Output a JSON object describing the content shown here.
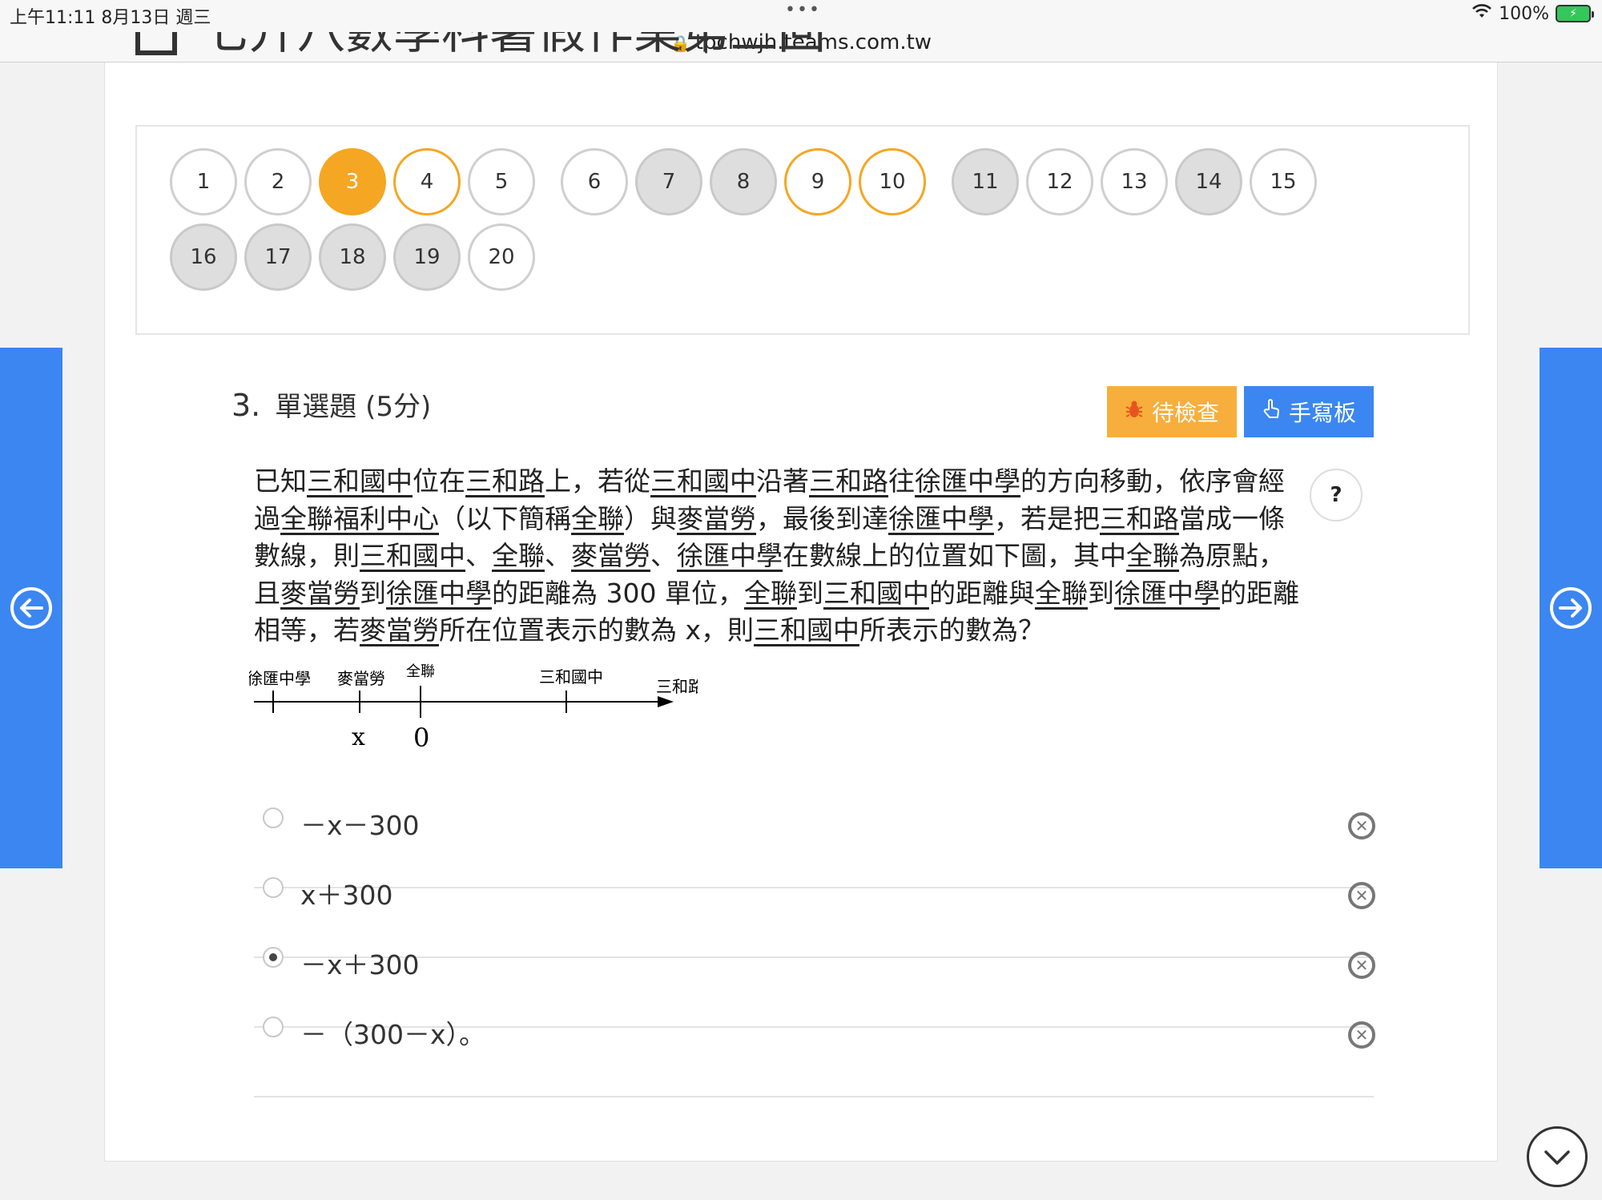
{
  "status_bar": {
    "time": "上午11:11   8月13日 週三",
    "dots": "•••",
    "url": "tpchwjh.teams.com.tw",
    "battery": "100%"
  },
  "page": {
    "title": "七升八數學科暑假作業第三回"
  },
  "question_nav": [
    {
      "label": "1",
      "state": "default"
    },
    {
      "label": "2",
      "state": "default"
    },
    {
      "label": "3",
      "state": "current"
    },
    {
      "label": "4",
      "state": "flagged"
    },
    {
      "label": "5",
      "state": "default"
    },
    {
      "label": "6",
      "state": "default"
    },
    {
      "label": "7",
      "state": "answered"
    },
    {
      "label": "8",
      "state": "answered"
    },
    {
      "label": "9",
      "state": "flagged"
    },
    {
      "label": "10",
      "state": "flagged"
    },
    {
      "label": "11",
      "state": "answered"
    },
    {
      "label": "12",
      "state": "default"
    },
    {
      "label": "13",
      "state": "default"
    },
    {
      "label": "14",
      "state": "answered"
    },
    {
      "label": "15",
      "state": "default"
    },
    {
      "label": "16",
      "state": "answered"
    },
    {
      "label": "17",
      "state": "answered"
    },
    {
      "label": "18",
      "state": "answered"
    },
    {
      "label": "19",
      "state": "answered"
    },
    {
      "label": "20",
      "state": "default"
    }
  ],
  "question": {
    "number": "3.",
    "type": "單選題 (5分)",
    "check_button": "待檢查",
    "handwrite_button": "手寫板",
    "help": "?",
    "text_parts": [
      {
        "t": "已知",
        "u": false
      },
      {
        "t": "三和國中",
        "u": true
      },
      {
        "t": "位在",
        "u": false
      },
      {
        "t": "三和路",
        "u": true
      },
      {
        "t": "上，若從",
        "u": false
      },
      {
        "t": "三和國中",
        "u": true
      },
      {
        "t": "沿著",
        "u": false
      },
      {
        "t": "三和路",
        "u": true
      },
      {
        "t": "往",
        "u": false
      },
      {
        "t": "徐匯中學",
        "u": true
      },
      {
        "t": "的方向移動，依序會經過",
        "u": false
      },
      {
        "t": "全聯福利中心",
        "u": true
      },
      {
        "t": "（以下簡稱",
        "u": false
      },
      {
        "t": "全聯",
        "u": true
      },
      {
        "t": "）與",
        "u": false
      },
      {
        "t": "麥當勞",
        "u": true
      },
      {
        "t": "，最後到達",
        "u": false
      },
      {
        "t": "徐匯中學",
        "u": true
      },
      {
        "t": "，若是把",
        "u": false
      },
      {
        "t": "三和路",
        "u": true
      },
      {
        "t": "當成一條數線，則",
        "u": false
      },
      {
        "t": "三和國中",
        "u": true
      },
      {
        "t": "、",
        "u": false
      },
      {
        "t": "全聯",
        "u": true
      },
      {
        "t": "、",
        "u": false
      },
      {
        "t": "麥當勞",
        "u": true
      },
      {
        "t": "、",
        "u": false
      },
      {
        "t": "徐匯中學",
        "u": true
      },
      {
        "t": "在數線上的位置如下圖，其中",
        "u": false
      },
      {
        "t": "全聯",
        "u": true
      },
      {
        "t": "為原點，且",
        "u": false
      },
      {
        "t": "麥當勞",
        "u": true
      },
      {
        "t": "到",
        "u": false
      },
      {
        "t": "徐匯中學",
        "u": true
      },
      {
        "t": "的距離為 300 單位，",
        "u": false
      },
      {
        "t": "全聯",
        "u": true
      },
      {
        "t": "到",
        "u": false
      },
      {
        "t": "三和國中",
        "u": true
      },
      {
        "t": "的距離與",
        "u": false
      },
      {
        "t": "全聯",
        "u": true
      },
      {
        "t": "到",
        "u": false
      },
      {
        "t": "徐匯中學",
        "u": true
      },
      {
        "t": "的距離相等，若",
        "u": false
      },
      {
        "t": "麥當勞",
        "u": true
      },
      {
        "t": "所在位置表示的數為 x，則",
        "u": false
      },
      {
        "t": "三和國中",
        "u": true
      },
      {
        "t": "所表示的數為？",
        "u": false
      }
    ],
    "diagram": {
      "labels": [
        "徐匯中學",
        "麥當勞",
        "全聯",
        "三和國中",
        "三和路"
      ],
      "values": [
        "x",
        "0"
      ]
    },
    "options": [
      {
        "label": "－x－300",
        "selected": false
      },
      {
        "label": "x＋300",
        "selected": false
      },
      {
        "label": "－x＋300",
        "selected": true
      },
      {
        "label": "－（300－x）。",
        "selected": false
      }
    ]
  }
}
